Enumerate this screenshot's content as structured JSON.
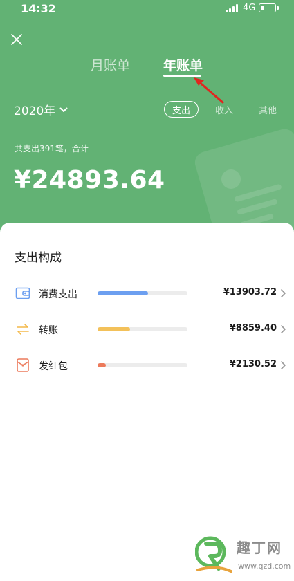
{
  "status_bar": {
    "time": "14:32",
    "network": "4G"
  },
  "tabs": [
    {
      "label": "月账单",
      "active": false
    },
    {
      "label": "年账单",
      "active": true
    }
  ],
  "year_selector": {
    "value": "2020年"
  },
  "filters": [
    {
      "label": "支出",
      "selected": true
    },
    {
      "label": "收入",
      "selected": false
    },
    {
      "label": "其他",
      "selected": false
    }
  ],
  "summary_text": "共支出391笔，合计",
  "total_amount": "¥24893.64",
  "section_title": "支出构成",
  "breakdown": [
    {
      "label": "消费支出",
      "amount": "¥13903.72",
      "icon": "wallet-icon",
      "color": "#6c9ff0",
      "ratio": 0.56
    },
    {
      "label": "转账",
      "amount": "¥8859.40",
      "icon": "transfer-icon",
      "color": "#f3c15a",
      "ratio": 0.36
    },
    {
      "label": "发红包",
      "amount": "¥2130.52",
      "icon": "red-envelope-icon",
      "color": "#ec7a5b",
      "ratio": 0.09
    }
  ],
  "watermark": {
    "text": "趣丁网",
    "url": "www.qzd.com"
  },
  "colors": {
    "header_green": "#62b274",
    "annotation_arrow": "#e0261f"
  }
}
